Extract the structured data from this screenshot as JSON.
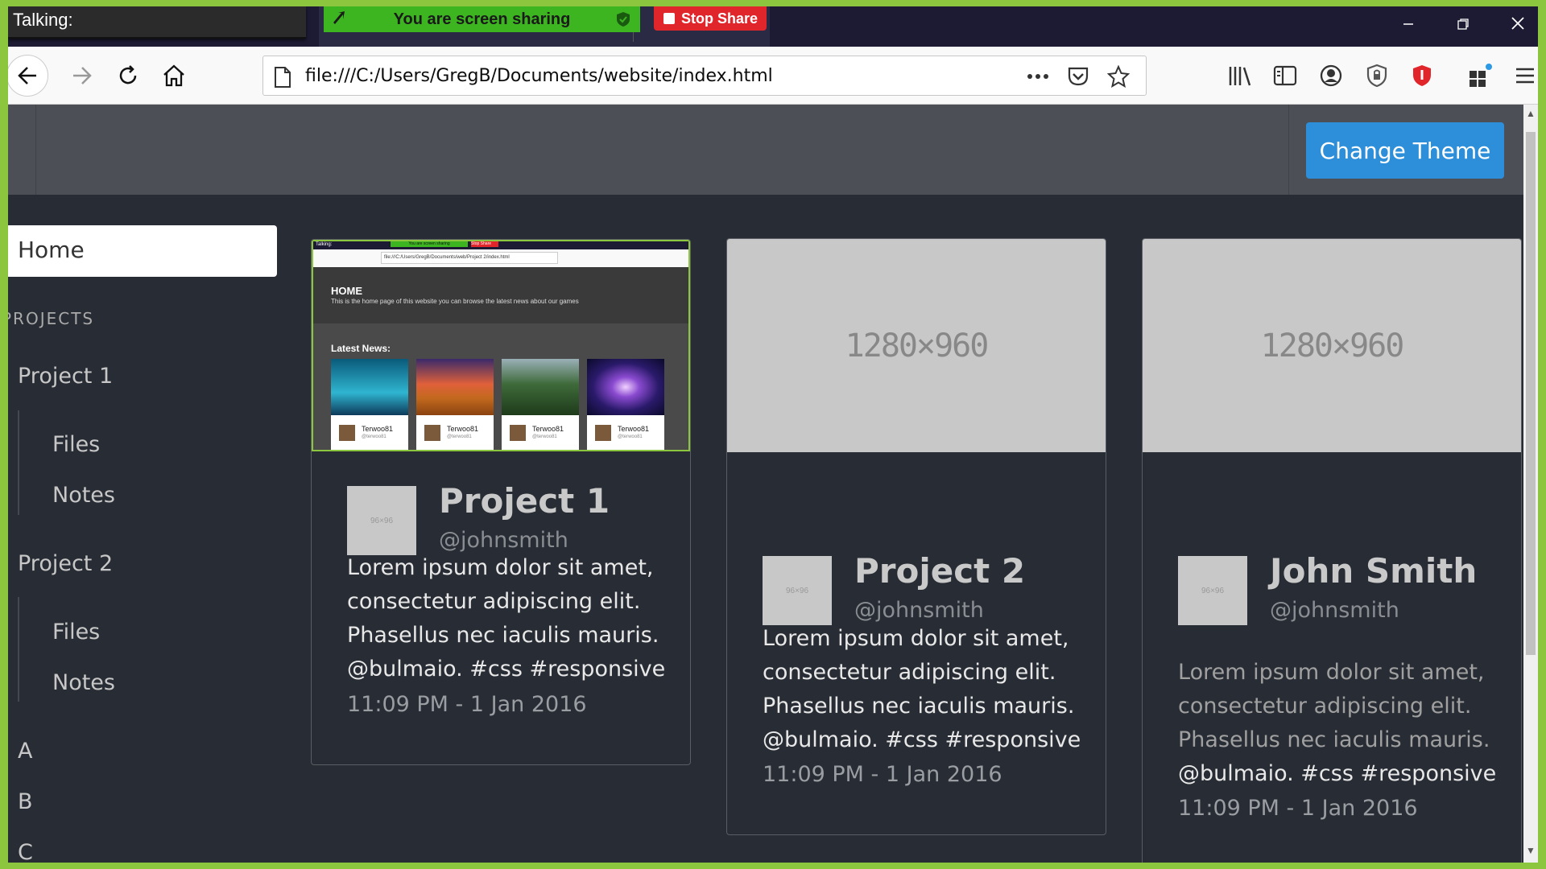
{
  "screen_share": {
    "talking_label": "Talking:",
    "sharing_text": "You are screen sharing",
    "stop_share_label": "Stop Share"
  },
  "browser": {
    "url": "file:///C:/Users/GregB/Documents/website/index.html",
    "window_controls": [
      "minimize",
      "restore",
      "close"
    ]
  },
  "page": {
    "theme_button_label": "Change Theme",
    "sidebar": {
      "home_label": "Home",
      "section_label": "PROJECTS",
      "items": [
        {
          "label": "Project 1",
          "children": [
            "Files",
            "Notes"
          ]
        },
        {
          "label": "Project 2",
          "children": [
            "Files",
            "Notes"
          ]
        },
        {
          "label": "A"
        },
        {
          "label": "B"
        },
        {
          "label": "C"
        }
      ]
    },
    "cards": [
      {
        "title": "Project 1",
        "handle": "@johnsmith",
        "body": "Lorem ipsum dolor sit amet, consectetur adipiscing elit. Phasellus nec iaculis mauris.",
        "tags": "@bulmaio. #css #responsive",
        "time": "11:09 PM - 1 Jan 2016",
        "thumb_label": "96×96",
        "preview": {
          "home_heading": "HOME",
          "home_sub": "This is the home page of this website you can browse the latest news about our games",
          "latest_news": "Latest News:",
          "news_author": "Terwoo81",
          "news_handle": "@terwoo81",
          "url": "file:///C:/Users/GregB/Documents/web/Project 2/index.html",
          "talking": "Talking:",
          "sharing": "You are screen sharing",
          "stop": "Stop Share"
        }
      },
      {
        "title": "Project 2",
        "handle": "@johnsmith",
        "image_label": "1280×960",
        "body": "Lorem ipsum dolor sit amet, consectetur adipiscing elit. Phasellus nec iaculis mauris.",
        "tags": "@bulmaio. #css #responsive",
        "time": "11:09 PM - 1 Jan 2016",
        "thumb_label": "96×96"
      },
      {
        "title": "John Smith",
        "handle": "@johnsmith",
        "image_label": "1280×960",
        "body": "Lorem ipsum dolor sit amet, consectetur adipiscing elit. Phasellus nec iaculis mauris.",
        "tags": "@bulmaio. #css #responsive",
        "time": "11:09 PM - 1 Jan 2016",
        "thumb_label": "96×96"
      }
    ]
  },
  "colors": {
    "share_border": "#8cc63f",
    "page_bg": "#282c34",
    "hero_bg": "#4c5056",
    "theme_button": "#2d8fd9",
    "sharing_green": "#3cb521",
    "stop_red": "#e0252b"
  }
}
